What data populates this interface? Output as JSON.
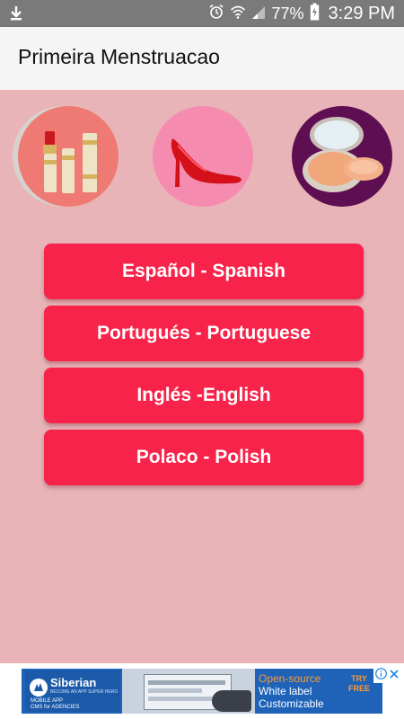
{
  "status_bar": {
    "battery_percent": "77%",
    "time": "3:29 PM",
    "icons": [
      "download-icon",
      "alarm-icon",
      "wifi-icon",
      "signal-icon",
      "battery-charging-icon"
    ]
  },
  "app_bar": {
    "title": "Primeira Menstruacao"
  },
  "images": [
    {
      "name": "lipstick-image",
      "bg": "#ef7a73"
    },
    {
      "name": "red-heel-shoe-image",
      "bg": "#f58cb0"
    },
    {
      "name": "compact-powder-image",
      "bg": "#5e0f52"
    }
  ],
  "languages": [
    {
      "label": "Español - Spanish"
    },
    {
      "label": "Portugués - Portuguese"
    },
    {
      "label": "Inglés -English"
    },
    {
      "label": "Polaco - Polish"
    }
  ],
  "ad": {
    "brand": "Siberian",
    "brand_tagline": "BECOME AN APP SUPER HERO",
    "product_line1": "MOBILE APP",
    "product_line2": "CMS for AGENCIES",
    "copy_line1": "Open-source",
    "copy_line2": "White label",
    "copy_line3": "Customizable",
    "cta_line1": "TRY",
    "cta_line2": "FREE"
  },
  "colors": {
    "background": "#e8b4b8",
    "button": "#f8234a",
    "app_bar": "#f5f5f5",
    "status_bar": "#7a7a7a"
  }
}
